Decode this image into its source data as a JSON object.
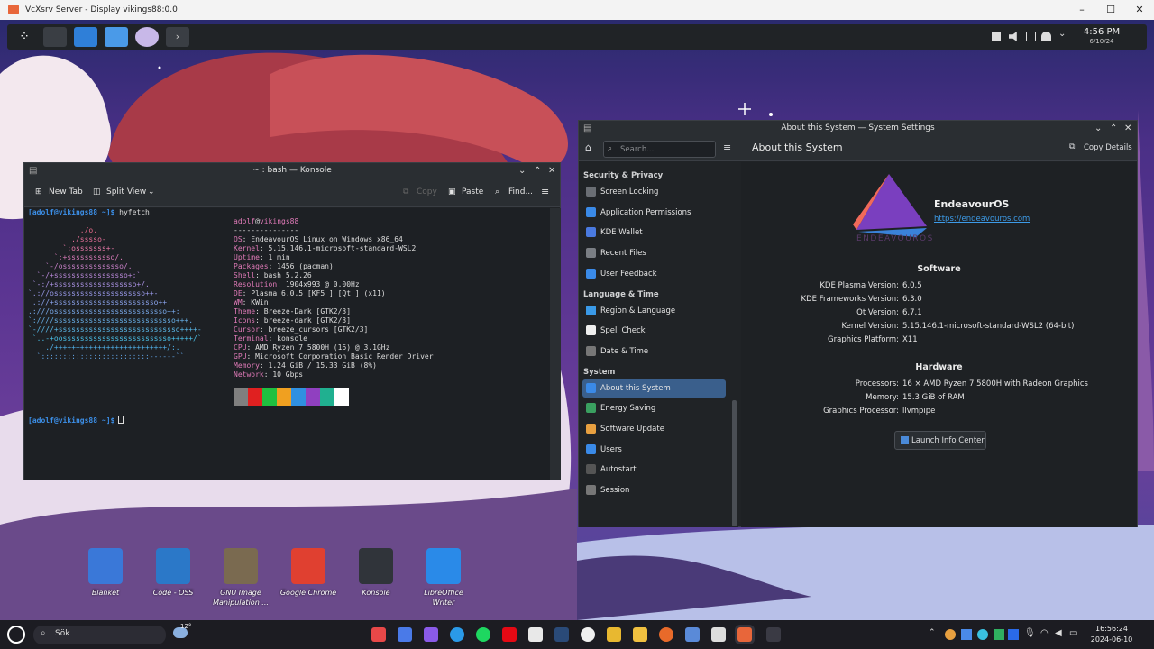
{
  "vcxsrv": {
    "title": "VcXsrv Server - Display vikings88:0.0",
    "min": "–",
    "max": "☐",
    "close": "✕"
  },
  "panel": {
    "time": "4:56 PM",
    "date": "6/10/24"
  },
  "konsole": {
    "title": "~ : bash — Konsole",
    "new_tab": "New Tab",
    "split_view": "Split View",
    "copy": "Copy",
    "paste": "Paste",
    "find": "Find...",
    "prompt": "[adolf@vikings88 ~]$",
    "command": " hyfetch",
    "logo": [
      "            ./o.",
      "          ./sssso-",
      "        `:osssssss+-",
      "      `:+sssssssssso/.",
      "    `-/ossssssssssssso/.",
      "  `-/+sssssssssssssssso+:`",
      " `-:/+sssssssssssssssssso+/.",
      "`.://osssssssssssssssssssso++-",
      " .://+ssssssssssssssssssssssso++:",
      ".:///ossssssssssssssssssssssssso++:",
      "`:////ssssssssssssssssssssssssssso+++.",
      "`-////+ssssssssssssssssssssssssssso++++-",
      " `..-+oosssssssssssssssssssssssso+++++/`",
      "    ./++++++++++++++++++++++++++/:.",
      "  `:::::::::::::::::::::::::------``"
    ],
    "user": "adolf",
    "at": "@",
    "host": "vikings88",
    "sep": "---------------",
    "info": [
      {
        "k": "OS",
        "v": "EndeavourOS Linux on Windows x86_64"
      },
      {
        "k": "Kernel",
        "v": "5.15.146.1-microsoft-standard-WSL2"
      },
      {
        "k": "Uptime",
        "v": "1 min"
      },
      {
        "k": "Packages",
        "v": "1456 (pacman)"
      },
      {
        "k": "Shell",
        "v": "bash 5.2.26"
      },
      {
        "k": "Resolution",
        "v": "1904x993 @ 0.00Hz"
      },
      {
        "k": "DE",
        "v": "Plasma 6.0.5 [KF5 ] [Qt ] (x11)"
      },
      {
        "k": "WM",
        "v": "KWin"
      },
      {
        "k": "Theme",
        "v": "Breeze-Dark [GTK2/3]"
      },
      {
        "k": "Icons",
        "v": "breeze-dark [GTK2/3]"
      },
      {
        "k": "Cursor",
        "v": "breeze_cursors [GTK2/3]"
      },
      {
        "k": "Terminal",
        "v": "konsole"
      },
      {
        "k": "CPU",
        "v": "AMD Ryzen 7 5800H (16) @ 3.1GHz"
      },
      {
        "k": "GPU",
        "v": "Microsoft Corporation Basic Render Driver"
      },
      {
        "k": "Memory",
        "v": "1.24 GiB / 15.33 GiB (8%)"
      },
      {
        "k": "Network",
        "v": "10 Gbps"
      }
    ],
    "palette": [
      "#7f7f7f",
      "#e02020",
      "#20c040",
      "#f0a020",
      "#3090e0",
      "#9040c0",
      "#20b090",
      "#ffffff"
    ]
  },
  "settings": {
    "title": "About this System — System Settings",
    "search_placeholder": "Search...",
    "page_title": "About this System",
    "copy_details": "Copy Details",
    "groups": [
      {
        "label": "Security & Privacy",
        "items": [
          "Screen Locking",
          "Application Permissions",
          "KDE Wallet",
          "Recent Files",
          "User Feedback"
        ]
      },
      {
        "label": "Language & Time",
        "items": [
          "Region & Language",
          "Spell Check",
          "Date & Time"
        ]
      },
      {
        "label": "System",
        "items": [
          "About this System",
          "Energy Saving",
          "Software Update",
          "Users",
          "Autostart",
          "Session"
        ]
      }
    ],
    "distro": "EndeavourOS",
    "logo_text": "ENDEAVOUROS",
    "url": "https://endeavouros.com",
    "software_title": "Software",
    "software": [
      {
        "k": "KDE Plasma Version:",
        "v": "6.0.5"
      },
      {
        "k": "KDE Frameworks Version:",
        "v": "6.3.0"
      },
      {
        "k": "Qt Version:",
        "v": "6.7.1"
      },
      {
        "k": "Kernel Version:",
        "v": "5.15.146.1-microsoft-standard-WSL2 (64-bit)"
      },
      {
        "k": "Graphics Platform:",
        "v": "X11"
      }
    ],
    "hardware_title": "Hardware",
    "hardware": [
      {
        "k": "Processors:",
        "v": "16 × AMD Ryzen 7 5800H with Radeon Graphics"
      },
      {
        "k": "Memory:",
        "v": "15.3 GiB of RAM"
      },
      {
        "k": "Graphics Processor:",
        "v": "llvmpipe"
      }
    ],
    "launch": "Launch Info Center"
  },
  "desktop_icons": [
    {
      "label": "Blanket",
      "color": "#3a78d8"
    },
    {
      "label": "Code - OSS",
      "color": "#2b78c8"
    },
    {
      "label": "GNU Image Manipulation ...",
      "color": "#7a6a50"
    },
    {
      "label": "Google Chrome",
      "color": "#e04030"
    },
    {
      "label": "Konsole",
      "color": "#30343a"
    },
    {
      "label": "LibreOffice Writer",
      "color": "#2a8ae8"
    }
  ],
  "taskbar": {
    "search": "Sök",
    "temp": "12°",
    "time": "16:56:24",
    "date": "2024-06-10"
  }
}
